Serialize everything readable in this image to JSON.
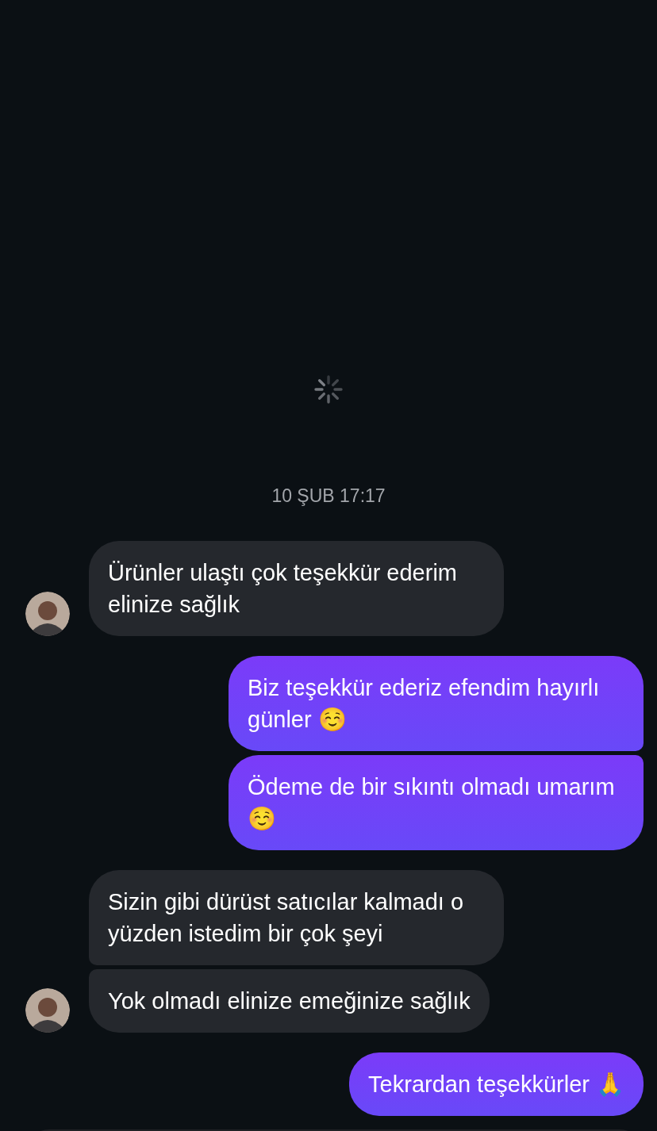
{
  "date_divider": "10 ŞUB 17:17",
  "messages": [
    {
      "kind": "incoming",
      "text": "Ürünler ulaştı çok teşekkür ederim elinize sağlık",
      "avatar": true
    },
    {
      "kind": "outgoing",
      "text": "Biz teşekkür ederiz efendim hayırlı günler ☺️"
    },
    {
      "kind": "outgoing",
      "text": "Ödeme de bir sıkıntı olmadı umarım ☺️"
    },
    {
      "kind": "incoming",
      "text": "Sizin gibi dürüst satıcılar kalmadı o yüzden istedim bir çok şeyi",
      "avatar": false
    },
    {
      "kind": "incoming",
      "text": "Yok olmadı elinize emeğinize sağlık",
      "avatar": true
    },
    {
      "kind": "outgoing",
      "text": "Tekrardan teşekkürler 🙏"
    }
  ]
}
